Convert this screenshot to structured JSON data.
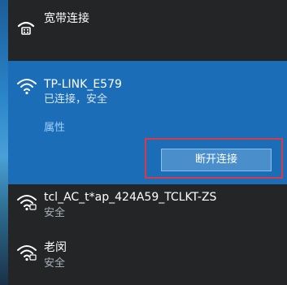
{
  "broadband": {
    "label": "宽带连接",
    "icon": "dialup-icon"
  },
  "selected_network": {
    "name": "TP-LINK_E579",
    "status": "已连接，安全",
    "properties_label": "属性",
    "disconnect_label": "断开连接",
    "icon": "wifi-signal-icon"
  },
  "networks": [
    {
      "name": "tcl_AC_t*ap_424A59_TCLKT-ZS",
      "status": "安全",
      "icon": "wifi-secured-icon"
    },
    {
      "name": "老闵",
      "status": "安全",
      "icon": "wifi-secured-icon"
    }
  ],
  "colors": {
    "panel_bg": "#232527",
    "selected_bg": "#1a6db6",
    "highlight_border": "#d83a48",
    "link": "#9fd0ff"
  }
}
